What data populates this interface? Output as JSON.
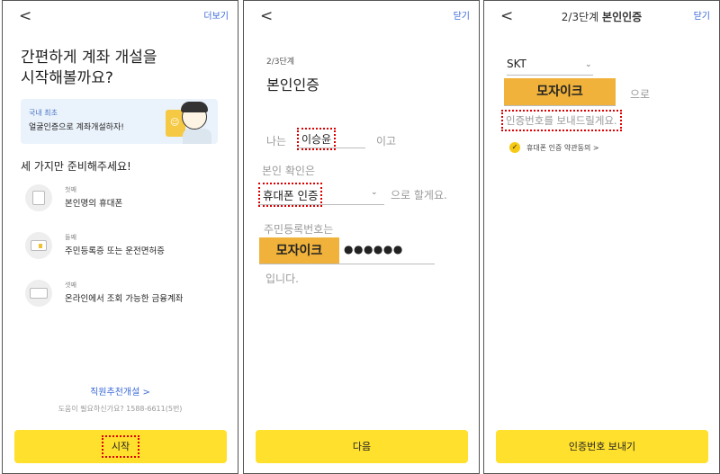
{
  "panel1": {
    "more_label": "더보기",
    "title_line1": "간편하게 계좌 개설을",
    "title_line2": "시작해볼까요?",
    "banner_small": "국내 최초",
    "banner_main": "얼굴인증으로 계좌개설하자!",
    "subtitle": "세 가지만 준비해주세요!",
    "steps": [
      {
        "ordinal": "첫째",
        "text": "본인명의 휴대폰"
      },
      {
        "ordinal": "둘째",
        "text": "주민등록증 또는 운전면허증"
      },
      {
        "ordinal": "셋째",
        "text": "온라인에서 조회 가능한 금융계좌"
      }
    ],
    "referral_link": "직원추천개설 >",
    "help_text": "도움이 필요하신가요? 1588-6611(5번)",
    "start_button": "시작"
  },
  "panel2": {
    "close_label": "닫기",
    "step_text": "2/3단계",
    "title": "본인인증",
    "prefix_name": "나는",
    "name_value": "이승윤",
    "suffix_name": "이고",
    "verify_label": "본인 확인은",
    "verify_method": "휴대폰 인증",
    "verify_suffix": "으로 할게요.",
    "ssn_label": "주민등록번호는",
    "mosaic_text": "모자이크",
    "ssn_masked": "●●●●●●",
    "ssn_suffix": "입니다.",
    "next_button": "다음"
  },
  "panel3": {
    "close_label": "닫기",
    "header_step": "2/3단계",
    "header_title": "본인인증",
    "carrier": "SKT",
    "mosaic_text": "모자이크",
    "mosaic_suffix": "으로",
    "send_message": "인증번호를 보내드릴게요.",
    "agree_text": "휴대폰 인증 약관동의 >",
    "send_button": "인증번호 보내기"
  },
  "colors": {
    "accent_yellow": "#ffe02d",
    "mosaic_orange": "#f0b23a",
    "link_blue": "#3a6ad8",
    "highlight_red": "#dd0000"
  }
}
